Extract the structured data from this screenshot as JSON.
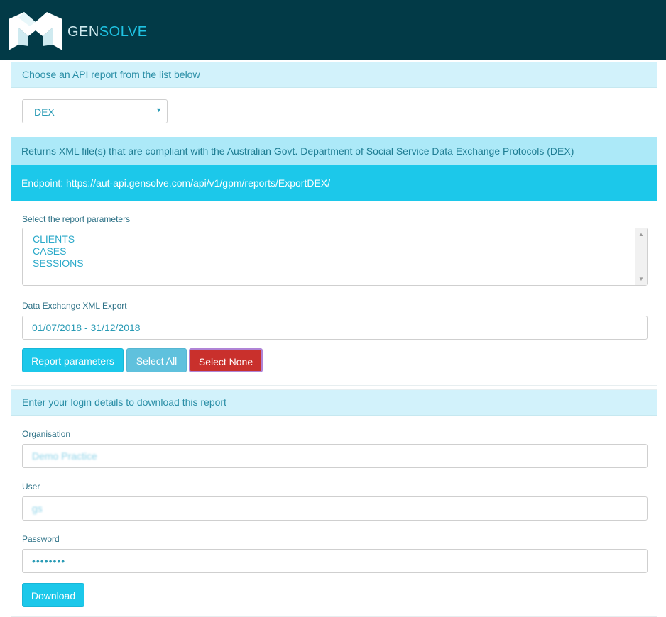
{
  "header": {
    "logo_icon": "gensolve-g-icon",
    "brand_prefix": "GEN",
    "brand_suffix": "SOLVE"
  },
  "report_chooser": {
    "heading": "Choose an API report from the list below",
    "selected_report": "DEX"
  },
  "report_info": {
    "description": "Returns XML file(s) that are compliant with the Australian Govt. Department of Social Service Data Exchange Protocols (DEX)",
    "endpoint": "Endpoint: https://aut-api.gensolve.com/api/v1/gpm/reports/ExportDEX/"
  },
  "parameters": {
    "label": "Select the report parameters",
    "options": [
      "CLIENTS",
      "CASES",
      "SESSIONS"
    ],
    "export_label": "Data Exchange XML Export",
    "date_range": "01/07/2018 - 31/12/2018",
    "buttons": {
      "report_parameters": "Report parameters",
      "select_all": "Select All",
      "select_none": "Select None"
    }
  },
  "login": {
    "heading": "Enter your login details to download this report",
    "organisation_label": "Organisation",
    "organisation_value": "Demo Practice",
    "user_label": "User",
    "user_value": "gs",
    "password_label": "Password",
    "password_value": "••••••••",
    "download_label": "Download"
  },
  "colors": {
    "topbar": "#023a47",
    "accent": "#1cc8ea",
    "heading_bg": "#d2f2fb",
    "danger": "#c9302c"
  }
}
